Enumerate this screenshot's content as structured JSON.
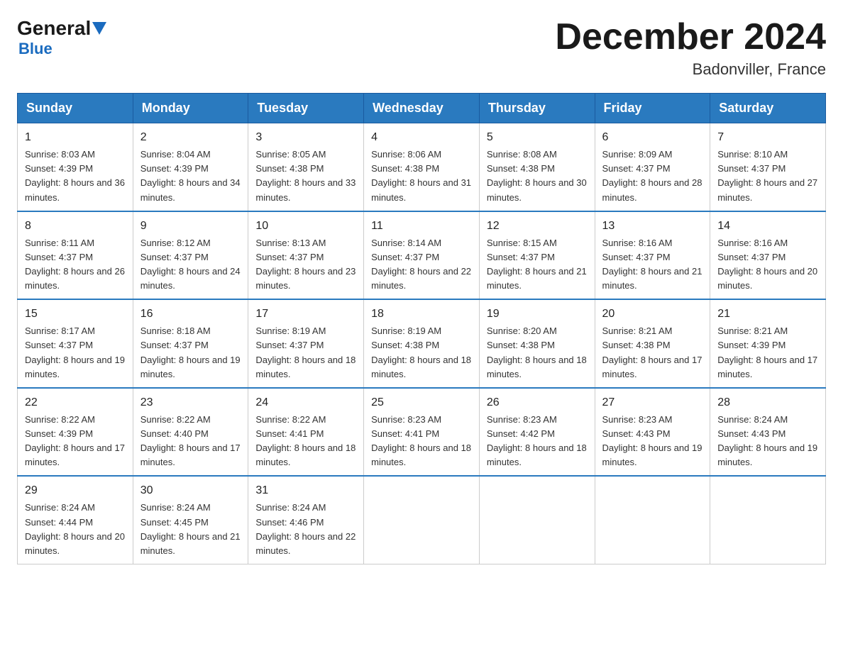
{
  "header": {
    "logo": {
      "general": "General",
      "blue": "Blue",
      "subtitle": "Blue"
    },
    "title": "December 2024",
    "location": "Badonviller, France"
  },
  "days_of_week": [
    "Sunday",
    "Monday",
    "Tuesday",
    "Wednesday",
    "Thursday",
    "Friday",
    "Saturday"
  ],
  "weeks": [
    [
      {
        "day": "1",
        "sunrise": "Sunrise: 8:03 AM",
        "sunset": "Sunset: 4:39 PM",
        "daylight": "Daylight: 8 hours and 36 minutes."
      },
      {
        "day": "2",
        "sunrise": "Sunrise: 8:04 AM",
        "sunset": "Sunset: 4:39 PM",
        "daylight": "Daylight: 8 hours and 34 minutes."
      },
      {
        "day": "3",
        "sunrise": "Sunrise: 8:05 AM",
        "sunset": "Sunset: 4:38 PM",
        "daylight": "Daylight: 8 hours and 33 minutes."
      },
      {
        "day": "4",
        "sunrise": "Sunrise: 8:06 AM",
        "sunset": "Sunset: 4:38 PM",
        "daylight": "Daylight: 8 hours and 31 minutes."
      },
      {
        "day": "5",
        "sunrise": "Sunrise: 8:08 AM",
        "sunset": "Sunset: 4:38 PM",
        "daylight": "Daylight: 8 hours and 30 minutes."
      },
      {
        "day": "6",
        "sunrise": "Sunrise: 8:09 AM",
        "sunset": "Sunset: 4:37 PM",
        "daylight": "Daylight: 8 hours and 28 minutes."
      },
      {
        "day": "7",
        "sunrise": "Sunrise: 8:10 AM",
        "sunset": "Sunset: 4:37 PM",
        "daylight": "Daylight: 8 hours and 27 minutes."
      }
    ],
    [
      {
        "day": "8",
        "sunrise": "Sunrise: 8:11 AM",
        "sunset": "Sunset: 4:37 PM",
        "daylight": "Daylight: 8 hours and 26 minutes."
      },
      {
        "day": "9",
        "sunrise": "Sunrise: 8:12 AM",
        "sunset": "Sunset: 4:37 PM",
        "daylight": "Daylight: 8 hours and 24 minutes."
      },
      {
        "day": "10",
        "sunrise": "Sunrise: 8:13 AM",
        "sunset": "Sunset: 4:37 PM",
        "daylight": "Daylight: 8 hours and 23 minutes."
      },
      {
        "day": "11",
        "sunrise": "Sunrise: 8:14 AM",
        "sunset": "Sunset: 4:37 PM",
        "daylight": "Daylight: 8 hours and 22 minutes."
      },
      {
        "day": "12",
        "sunrise": "Sunrise: 8:15 AM",
        "sunset": "Sunset: 4:37 PM",
        "daylight": "Daylight: 8 hours and 21 minutes."
      },
      {
        "day": "13",
        "sunrise": "Sunrise: 8:16 AM",
        "sunset": "Sunset: 4:37 PM",
        "daylight": "Daylight: 8 hours and 21 minutes."
      },
      {
        "day": "14",
        "sunrise": "Sunrise: 8:16 AM",
        "sunset": "Sunset: 4:37 PM",
        "daylight": "Daylight: 8 hours and 20 minutes."
      }
    ],
    [
      {
        "day": "15",
        "sunrise": "Sunrise: 8:17 AM",
        "sunset": "Sunset: 4:37 PM",
        "daylight": "Daylight: 8 hours and 19 minutes."
      },
      {
        "day": "16",
        "sunrise": "Sunrise: 8:18 AM",
        "sunset": "Sunset: 4:37 PM",
        "daylight": "Daylight: 8 hours and 19 minutes."
      },
      {
        "day": "17",
        "sunrise": "Sunrise: 8:19 AM",
        "sunset": "Sunset: 4:37 PM",
        "daylight": "Daylight: 8 hours and 18 minutes."
      },
      {
        "day": "18",
        "sunrise": "Sunrise: 8:19 AM",
        "sunset": "Sunset: 4:38 PM",
        "daylight": "Daylight: 8 hours and 18 minutes."
      },
      {
        "day": "19",
        "sunrise": "Sunrise: 8:20 AM",
        "sunset": "Sunset: 4:38 PM",
        "daylight": "Daylight: 8 hours and 18 minutes."
      },
      {
        "day": "20",
        "sunrise": "Sunrise: 8:21 AM",
        "sunset": "Sunset: 4:38 PM",
        "daylight": "Daylight: 8 hours and 17 minutes."
      },
      {
        "day": "21",
        "sunrise": "Sunrise: 8:21 AM",
        "sunset": "Sunset: 4:39 PM",
        "daylight": "Daylight: 8 hours and 17 minutes."
      }
    ],
    [
      {
        "day": "22",
        "sunrise": "Sunrise: 8:22 AM",
        "sunset": "Sunset: 4:39 PM",
        "daylight": "Daylight: 8 hours and 17 minutes."
      },
      {
        "day": "23",
        "sunrise": "Sunrise: 8:22 AM",
        "sunset": "Sunset: 4:40 PM",
        "daylight": "Daylight: 8 hours and 17 minutes."
      },
      {
        "day": "24",
        "sunrise": "Sunrise: 8:22 AM",
        "sunset": "Sunset: 4:41 PM",
        "daylight": "Daylight: 8 hours and 18 minutes."
      },
      {
        "day": "25",
        "sunrise": "Sunrise: 8:23 AM",
        "sunset": "Sunset: 4:41 PM",
        "daylight": "Daylight: 8 hours and 18 minutes."
      },
      {
        "day": "26",
        "sunrise": "Sunrise: 8:23 AM",
        "sunset": "Sunset: 4:42 PM",
        "daylight": "Daylight: 8 hours and 18 minutes."
      },
      {
        "day": "27",
        "sunrise": "Sunrise: 8:23 AM",
        "sunset": "Sunset: 4:43 PM",
        "daylight": "Daylight: 8 hours and 19 minutes."
      },
      {
        "day": "28",
        "sunrise": "Sunrise: 8:24 AM",
        "sunset": "Sunset: 4:43 PM",
        "daylight": "Daylight: 8 hours and 19 minutes."
      }
    ],
    [
      {
        "day": "29",
        "sunrise": "Sunrise: 8:24 AM",
        "sunset": "Sunset: 4:44 PM",
        "daylight": "Daylight: 8 hours and 20 minutes."
      },
      {
        "day": "30",
        "sunrise": "Sunrise: 8:24 AM",
        "sunset": "Sunset: 4:45 PM",
        "daylight": "Daylight: 8 hours and 21 minutes."
      },
      {
        "day": "31",
        "sunrise": "Sunrise: 8:24 AM",
        "sunset": "Sunset: 4:46 PM",
        "daylight": "Daylight: 8 hours and 22 minutes."
      },
      null,
      null,
      null,
      null
    ]
  ]
}
